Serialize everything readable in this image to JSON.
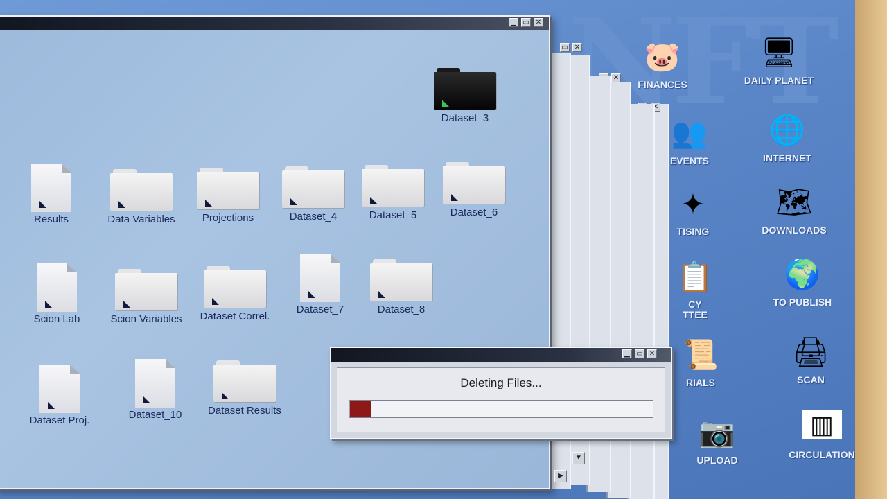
{
  "desktop": {
    "logo": "NFT",
    "icons": [
      {
        "label": "FINANCES",
        "icon": "piggy-bank-icon",
        "glyph": "🐷"
      },
      {
        "label": "DAILY PLANET",
        "icon": "monitor-icon",
        "glyph": "🖥"
      },
      {
        "label": "INTERNET",
        "icon": "globe-icon",
        "glyph": "🌐"
      },
      {
        "label": "EVENTS",
        "icon": "people-icon",
        "glyph": "👥"
      },
      {
        "label": "DOWNLOADS",
        "icon": "download-globe-icon",
        "glyph": "🗺"
      },
      {
        "label": "TISING",
        "icon": "advertising-icon",
        "glyph": "✦"
      },
      {
        "label": "TO PUBLISH",
        "icon": "daily-planet-globe-icon",
        "glyph": "🌍"
      },
      {
        "label": "CY\nTTEE",
        "icon": "committee-icon",
        "glyph": "📋"
      },
      {
        "label": "SCAN",
        "icon": "scanner-icon",
        "glyph": "🖨"
      },
      {
        "label": "RIALS",
        "icon": "tutorials-icon",
        "glyph": "📜"
      },
      {
        "label": "UPLOAD",
        "icon": "camera-icon",
        "glyph": "📷"
      },
      {
        "label": "CIRCULATION",
        "icon": "barcode-icon",
        "glyph": "▥"
      }
    ]
  },
  "window": {
    "items": [
      {
        "label": "Dataset_3",
        "type": "folder-dark"
      },
      {
        "label": "Results",
        "type": "doc"
      },
      {
        "label": "Data Variables",
        "type": "folder"
      },
      {
        "label": "Projections",
        "type": "folder"
      },
      {
        "label": "Dataset_4",
        "type": "folder"
      },
      {
        "label": "Dataset_5",
        "type": "folder"
      },
      {
        "label": "Dataset_6",
        "type": "folder"
      },
      {
        "label": "Scion Lab",
        "type": "doc"
      },
      {
        "label": "Scion Variables",
        "type": "folder"
      },
      {
        "label": "Dataset Correl.",
        "type": "folder"
      },
      {
        "label": "Dataset_7",
        "type": "doc"
      },
      {
        "label": "Dataset_8",
        "type": "folder"
      },
      {
        "label": "Dataset Proj.",
        "type": "doc"
      },
      {
        "label": "Dataset_10",
        "type": "doc"
      },
      {
        "label": "Dataset Results",
        "type": "folder"
      }
    ],
    "title_buttons": {
      "minimize": "▁",
      "maximize": "▭",
      "close": "✕"
    },
    "scroll": {
      "down": "▼",
      "right": "▶"
    }
  },
  "dialog": {
    "message": "Deleting Files...",
    "progress": 0.07,
    "progress_color": "#8e1818"
  }
}
